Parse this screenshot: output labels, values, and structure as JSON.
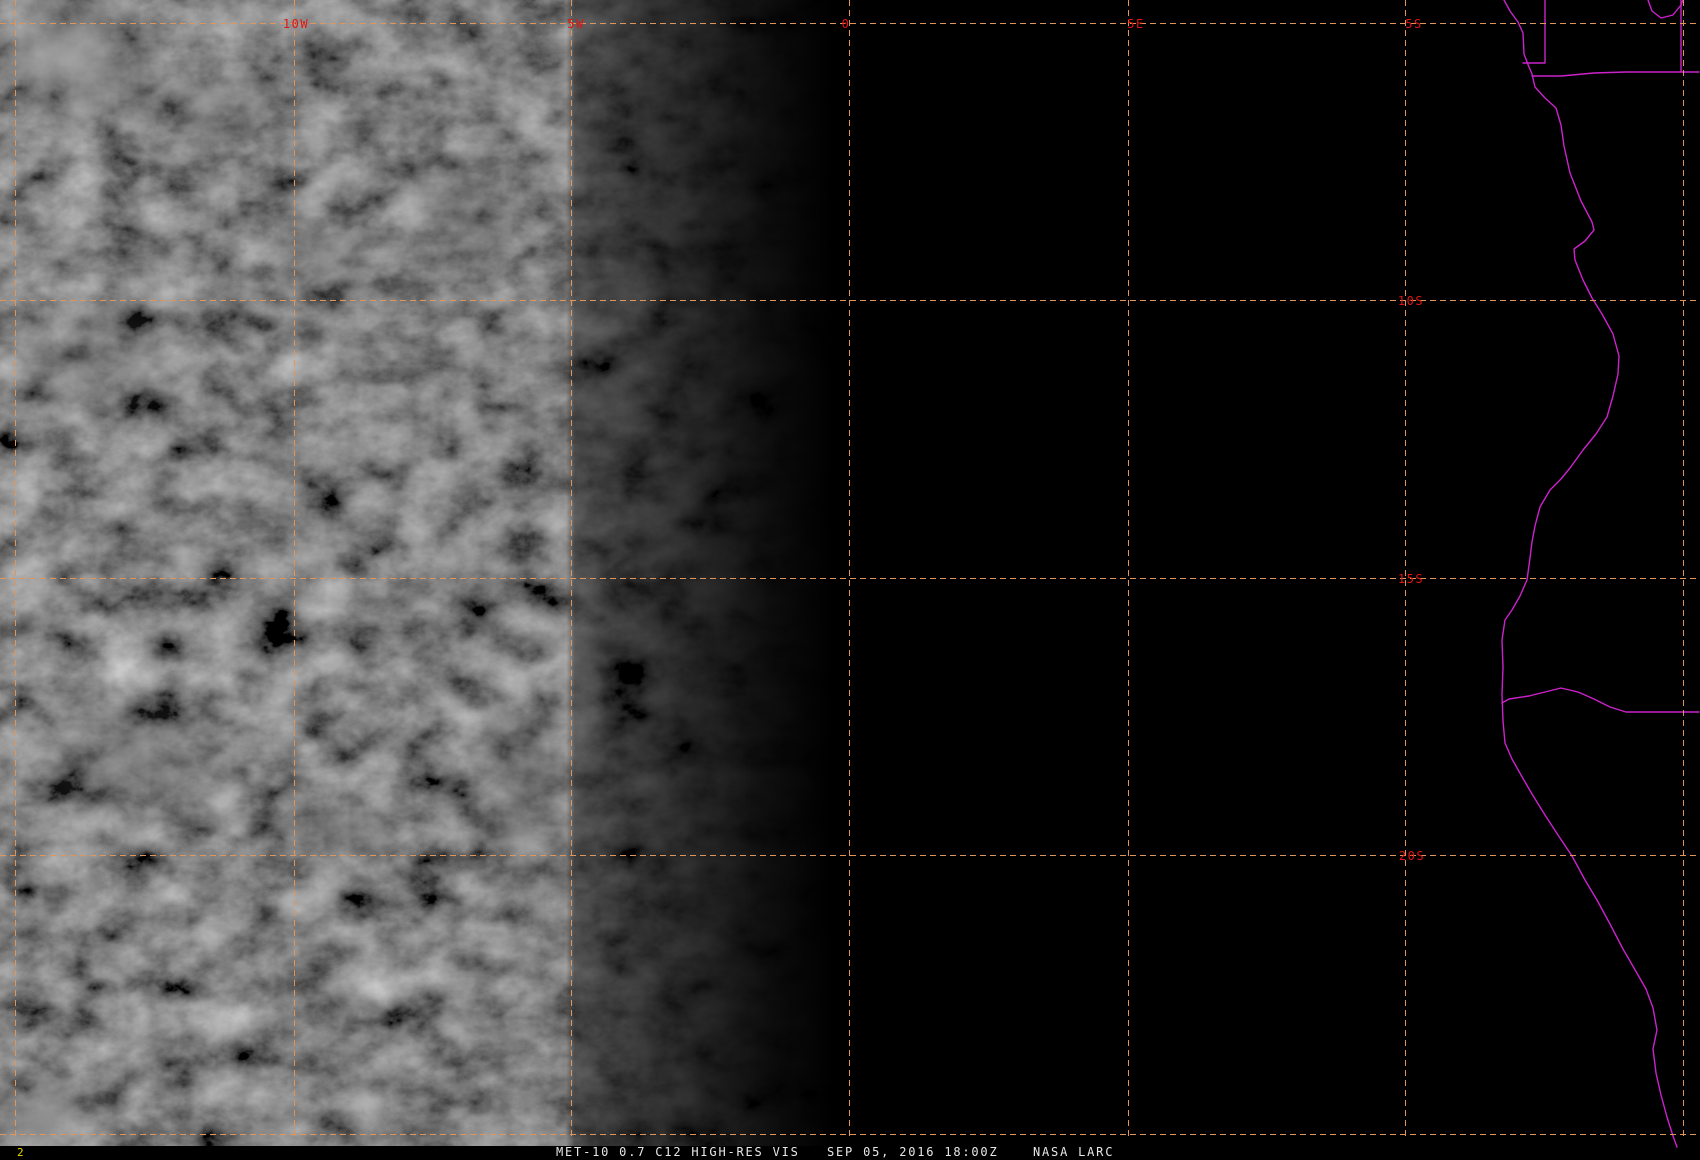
{
  "display": {
    "frame_number": "2",
    "status": {
      "product": "MET-10 0.7 C12 HIGH-RES VIS",
      "datetime": "SEP 05, 2016 18:00Z",
      "source": "NASA LARC"
    }
  },
  "grid": {
    "lon_labels": [
      "10W",
      "5W",
      "0",
      "5E"
    ],
    "lat_labels": [
      "5S",
      "10S",
      "15S",
      "20S"
    ]
  },
  "colors": {
    "background": "#000000",
    "grid_line": "#e0955a",
    "grid_label": "#e01414",
    "coastline": "#cc22cc",
    "status_text": "#e8e8e8",
    "frame_number": "#e8d800"
  }
}
